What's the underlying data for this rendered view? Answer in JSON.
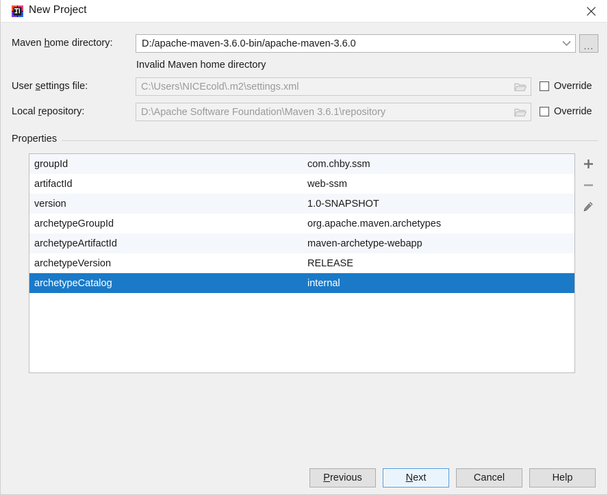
{
  "window": {
    "title": "New Project",
    "icon": "intellij-idea-logo-icon",
    "close_icon": "close-icon"
  },
  "form": {
    "maven_home": {
      "label_prefix": "Maven ",
      "label_mnemonic": "h",
      "label_suffix": "ome directory:",
      "value": "D:/apache-maven-3.6.0-bin/apache-maven-3.6.0",
      "dropdown_icon": "chevron-down-icon",
      "browse_label": "...",
      "error_message": "Invalid Maven home directory"
    },
    "user_settings": {
      "label_prefix": "User ",
      "label_mnemonic": "s",
      "label_suffix": "ettings file:",
      "value": "C:\\Users\\NICEcold\\.m2\\settings.xml",
      "folder_icon": "folder-icon",
      "override_label": "Override",
      "override_checked": false
    },
    "local_repository": {
      "label_prefix": "Local ",
      "label_mnemonic": "r",
      "label_suffix": "epository:",
      "value": "D:\\Apache Software Foundation\\Maven 3.6.1\\repository",
      "folder_icon": "folder-icon",
      "override_label": "Override",
      "override_checked": false
    }
  },
  "properties": {
    "group_title": "Properties",
    "rows": [
      {
        "key": "groupId",
        "value": "com.chby.ssm"
      },
      {
        "key": "artifactId",
        "value": "web-ssm"
      },
      {
        "key": "version",
        "value": "1.0-SNAPSHOT"
      },
      {
        "key": "archetypeGroupId",
        "value": "org.apache.maven.archetypes"
      },
      {
        "key": "archetypeArtifactId",
        "value": "maven-archetype-webapp"
      },
      {
        "key": "archetypeVersion",
        "value": "RELEASE"
      },
      {
        "key": "archetypeCatalog",
        "value": "internal"
      }
    ],
    "selected_index": 6,
    "selection_color": "#1a7ac8",
    "toolbar": [
      {
        "name": "add-property-button",
        "icon": "plus-icon"
      },
      {
        "name": "remove-property-button",
        "icon": "minus-icon"
      },
      {
        "name": "edit-property-button",
        "icon": "pencil-icon"
      }
    ]
  },
  "footer": {
    "previous": {
      "prefix": "",
      "mnemonic": "P",
      "suffix": "revious"
    },
    "next": {
      "prefix": "",
      "mnemonic": "N",
      "suffix": "ext"
    },
    "cancel": "Cancel",
    "help": "Help",
    "default_button": "next"
  }
}
